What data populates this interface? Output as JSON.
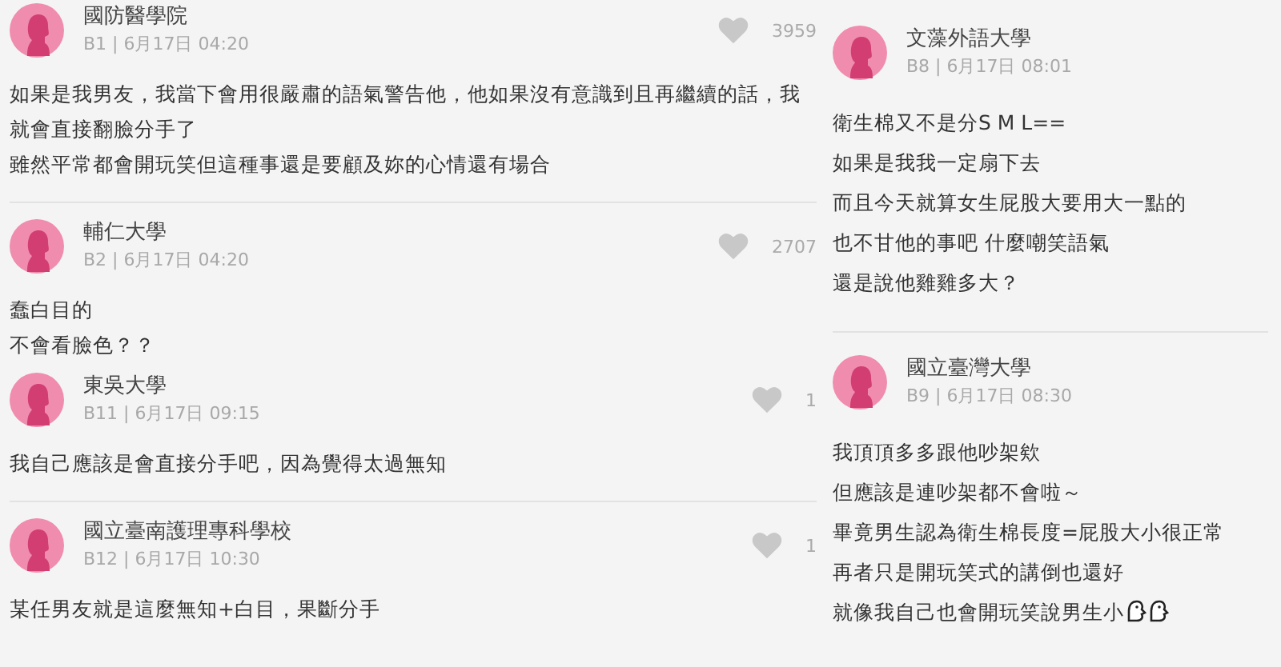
{
  "left_column": {
    "comments": [
      {
        "author": "國防醫學院",
        "meta": "B1 | 6月17日 04:20",
        "likes": "3959",
        "body": [
          "如果是我男友，我當下會用很嚴肅的語氣警告他，他如果沒有意識到且再繼續的話，我就會直接翻臉分手了",
          "雖然平常都會開玩笑但這種事還是要顧及妳的心情還有場合"
        ],
        "divider_after": true
      },
      {
        "author": "輔仁大學",
        "meta": "B2 | 6月17日 04:20",
        "likes": "2707",
        "body": [
          "蠢白目的",
          "不會看臉色？？"
        ],
        "divider_after": false
      },
      {
        "author": "東吳大學",
        "meta": "B11 | 6月17日 09:15",
        "likes": "1",
        "body": [
          "我自己應該是會直接分手吧，因為覺得太過無知"
        ],
        "divider_after": true
      },
      {
        "author": "國立臺南護理專科學校",
        "meta": "B12 | 6月17日 10:30",
        "likes": "1",
        "body": [
          "某任男友就是這麼無知+白目，果斷分手"
        ],
        "divider_after": false
      }
    ]
  },
  "right_column": {
    "comments": [
      {
        "author": "文藻外語大學",
        "meta": "B8 | 6月17日 08:01",
        "body": [
          "衛生棉又不是分S M L==",
          "如果是我我一定扇下去",
          "而且今天就算女生屁股大要用大一點的",
          "也不甘他的事吧 什麼嘲笑語氣",
          "還是說他雞雞多大？"
        ],
        "divider_after": true
      },
      {
        "author": "國立臺灣大學",
        "meta": "B9 | 6月17日 08:30",
        "body": [
          "我頂頂多多跟他吵架欸",
          "但應該是連吵架都不會啦～",
          "畢竟男生認為衛生棉長度=屁股大小很正常",
          "再者只是開玩笑式的講倒也還好",
          "就像我自己也會開玩笑說男生小"
        ],
        "trailing_icons": [
          {
            "kind": "chicken"
          },
          {
            "kind": "chicken"
          }
        ],
        "divider_after": false
      }
    ]
  }
}
